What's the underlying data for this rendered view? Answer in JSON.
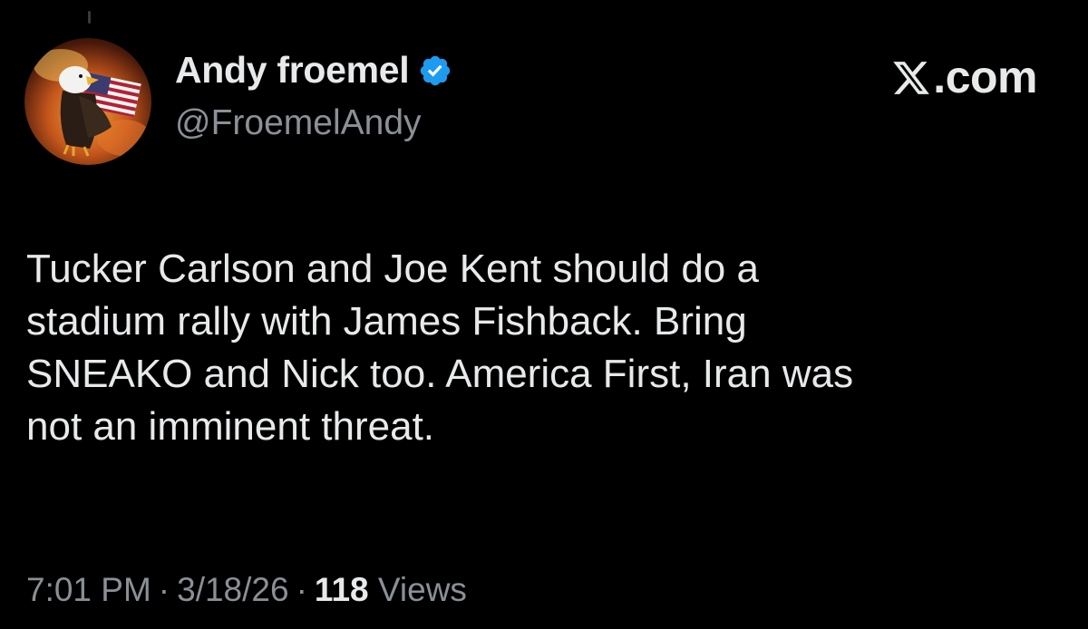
{
  "author": {
    "display_name": "Andy froemel",
    "handle": "@FroemelAndy",
    "verified": true,
    "verified_icon": "verified-badge-icon",
    "avatar": "bald-eagle-american-flag-avatar"
  },
  "brand": {
    "text": ".com",
    "logo_icon": "x-logo-icon"
  },
  "tweet": {
    "lines": [
      "Tucker Carlson and Joe Kent should do a",
      "stadium rally with James Fishback. Bring",
      "SNEAKO and Nick too. America First, Iran was",
      "not an imminent threat."
    ]
  },
  "meta": {
    "time": "7:01 PM",
    "separator": "·",
    "date": "3/18/26",
    "views_count": "118",
    "views_label": "Views"
  },
  "colors": {
    "background": "#000000",
    "primary_text": "#e7e9ea",
    "secondary_text": "#8b9096",
    "verified_blue": "#1d9bf0"
  }
}
